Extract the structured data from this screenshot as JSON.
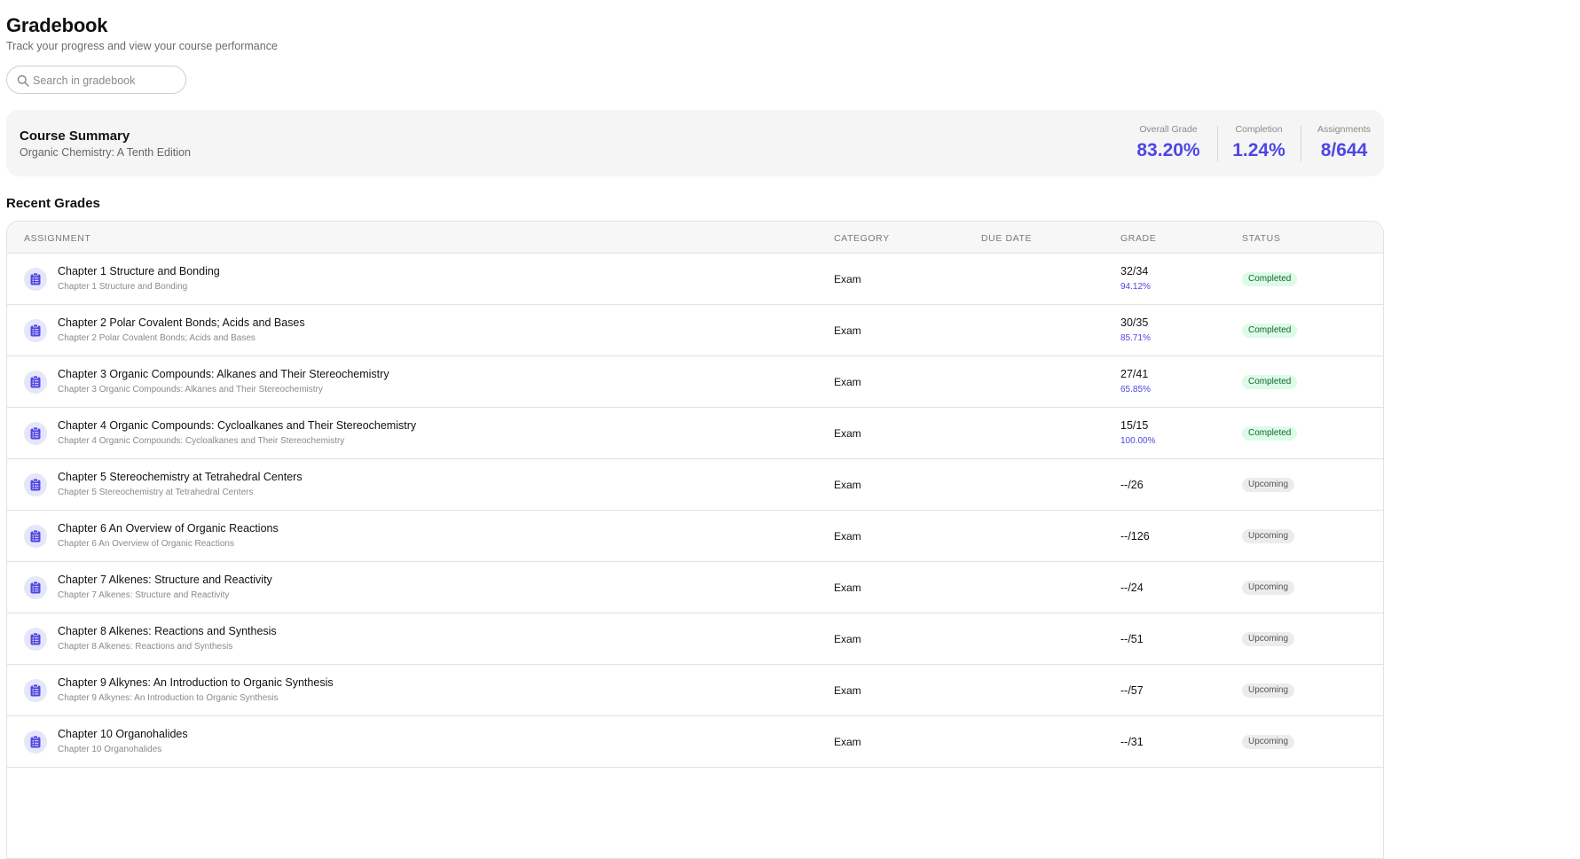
{
  "header": {
    "title": "Gradebook",
    "subtitle": "Track your progress and view your course performance"
  },
  "search": {
    "placeholder": "Search in gradebook",
    "value": ""
  },
  "summary": {
    "title": "Course Summary",
    "course": "Organic Chemistry: A Tenth Edition",
    "stats": [
      {
        "label": "Overall Grade",
        "value": "83.20%"
      },
      {
        "label": "Completion",
        "value": "1.24%"
      },
      {
        "label": "Assignments",
        "value": "8/644"
      }
    ]
  },
  "recent": {
    "title": "Recent Grades",
    "columns": [
      "ASSIGNMENT",
      "CATEGORY",
      "DUE DATE",
      "GRADE",
      "STATUS"
    ],
    "rows": [
      {
        "title": "Chapter 1 Structure and Bonding",
        "subtitle": "Chapter 1 Structure and Bonding",
        "category": "Exam",
        "due": "",
        "grade": "32/34",
        "percent": "94.12%",
        "status": "Completed"
      },
      {
        "title": "Chapter 2 Polar Covalent Bonds; Acids and Bases",
        "subtitle": "Chapter 2 Polar Covalent Bonds; Acids and Bases",
        "category": "Exam",
        "due": "",
        "grade": "30/35",
        "percent": "85.71%",
        "status": "Completed"
      },
      {
        "title": "Chapter 3 Organic Compounds: Alkanes and Their Stereochemistry",
        "subtitle": "Chapter 3 Organic Compounds: Alkanes and Their Stereochemistry",
        "category": "Exam",
        "due": "",
        "grade": "27/41",
        "percent": "65.85%",
        "status": "Completed"
      },
      {
        "title": "Chapter 4 Organic Compounds: Cycloalkanes and Their Stereochemistry",
        "subtitle": "Chapter 4 Organic Compounds: Cycloalkanes and Their Stereochemistry",
        "category": "Exam",
        "due": "",
        "grade": "15/15",
        "percent": "100.00%",
        "status": "Completed"
      },
      {
        "title": "Chapter 5 Stereochemistry at Tetrahedral Centers",
        "subtitle": "Chapter 5 Stereochemistry at Tetrahedral Centers",
        "category": "Exam",
        "due": "",
        "grade": "--/26",
        "percent": "",
        "status": "Upcoming"
      },
      {
        "title": "Chapter 6 An Overview of Organic Reactions",
        "subtitle": "Chapter 6 An Overview of Organic Reactions",
        "category": "Exam",
        "due": "",
        "grade": "--/126",
        "percent": "",
        "status": "Upcoming"
      },
      {
        "title": "Chapter 7 Alkenes: Structure and Reactivity",
        "subtitle": "Chapter 7 Alkenes: Structure and Reactivity",
        "category": "Exam",
        "due": "",
        "grade": "--/24",
        "percent": "",
        "status": "Upcoming"
      },
      {
        "title": "Chapter 8 Alkenes: Reactions and Synthesis",
        "subtitle": "Chapter 8 Alkenes: Reactions and Synthesis",
        "category": "Exam",
        "due": "",
        "grade": "--/51",
        "percent": "",
        "status": "Upcoming"
      },
      {
        "title": "Chapter 9 Alkynes: An Introduction to Organic Synthesis",
        "subtitle": "Chapter 9 Alkynes: An Introduction to Organic Synthesis",
        "category": "Exam",
        "due": "",
        "grade": "--/57",
        "percent": "",
        "status": "Upcoming"
      },
      {
        "title": "Chapter 10 Organohalides",
        "subtitle": "Chapter 10 Organohalides",
        "category": "Exam",
        "due": "",
        "grade": "--/31",
        "percent": "",
        "status": "Upcoming"
      }
    ]
  },
  "colors": {
    "accent": "#4f46e5",
    "completed_bg": "#dcfce7",
    "completed_text": "#166534",
    "upcoming_bg": "#ececec"
  },
  "icons": {
    "search": "search-icon",
    "assignment": "clipboard-icon"
  }
}
